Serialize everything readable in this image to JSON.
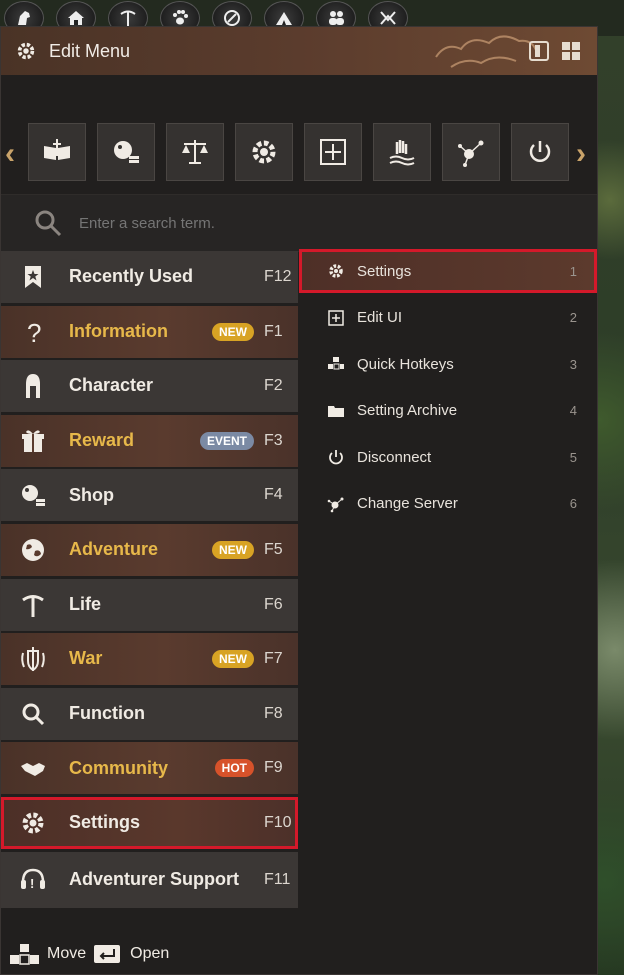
{
  "top_bar": {
    "buttons": [
      {
        "icon": "horse-head-icon"
      },
      {
        "icon": "house-icon"
      },
      {
        "icon": "pickaxe-icon"
      },
      {
        "icon": "paw-icon"
      },
      {
        "icon": "compass-icon"
      },
      {
        "icon": "tent-icon"
      },
      {
        "icon": "people-icon"
      },
      {
        "icon": "guild-icon"
      }
    ]
  },
  "window": {
    "title": "Edit Menu",
    "title_icon": "gear-icon"
  },
  "quick_icons": [
    {
      "icon": "book-sword-icon"
    },
    {
      "icon": "pearl-coins-icon"
    },
    {
      "icon": "scales-icon"
    },
    {
      "icon": "gear-icon"
    },
    {
      "icon": "edit-ui-icon"
    },
    {
      "icon": "hand-water-icon"
    },
    {
      "icon": "network-icon"
    },
    {
      "icon": "power-icon"
    }
  ],
  "search": {
    "placeholder": "Enter a search term."
  },
  "categories": [
    {
      "label": "Recently Used",
      "key": "F12",
      "badge": "",
      "icon": "star-bookmark-icon",
      "highlight": false
    },
    {
      "label": "Information",
      "key": "F1",
      "badge": "NEW",
      "icon": "question-icon",
      "highlight": true
    },
    {
      "label": "Character",
      "key": "F2",
      "badge": "",
      "icon": "helmet-icon",
      "highlight": false
    },
    {
      "label": "Reward",
      "key": "F3",
      "badge": "EVENT",
      "icon": "gift-icon",
      "highlight": true
    },
    {
      "label": "Shop",
      "key": "F4",
      "badge": "",
      "icon": "pearl-coins-icon",
      "highlight": false
    },
    {
      "label": "Adventure",
      "key": "F5",
      "badge": "NEW",
      "icon": "globe-icon",
      "highlight": true
    },
    {
      "label": "Life",
      "key": "F6",
      "badge": "",
      "icon": "pickaxe-icon",
      "highlight": false
    },
    {
      "label": "War",
      "key": "F7",
      "badge": "NEW",
      "icon": "sword-shield-icon",
      "highlight": true
    },
    {
      "label": "Function",
      "key": "F8",
      "badge": "",
      "icon": "magnifier-icon",
      "highlight": false
    },
    {
      "label": "Community",
      "key": "F9",
      "badge": "HOT",
      "icon": "handshake-icon",
      "highlight": true
    },
    {
      "label": "Settings",
      "key": "F10",
      "badge": "",
      "icon": "gear-icon",
      "highlight": false,
      "selected": true
    },
    {
      "label": "Adventurer Support",
      "key": "F11",
      "badge": "",
      "icon": "headset-icon",
      "highlight": false
    }
  ],
  "submenu": [
    {
      "label": "Settings",
      "num": "1",
      "icon": "gear-icon",
      "selected": true
    },
    {
      "label": "Edit UI",
      "num": "2",
      "icon": "edit-ui-icon"
    },
    {
      "label": "Quick Hotkeys",
      "num": "3",
      "icon": "keys-icon"
    },
    {
      "label": "Setting Archive",
      "num": "4",
      "icon": "folder-icon"
    },
    {
      "label": "Disconnect",
      "num": "5",
      "icon": "power-icon"
    },
    {
      "label": "Change Server",
      "num": "6",
      "icon": "network-icon"
    }
  ],
  "footer": {
    "move_label": "Move",
    "open_label": "Open"
  }
}
